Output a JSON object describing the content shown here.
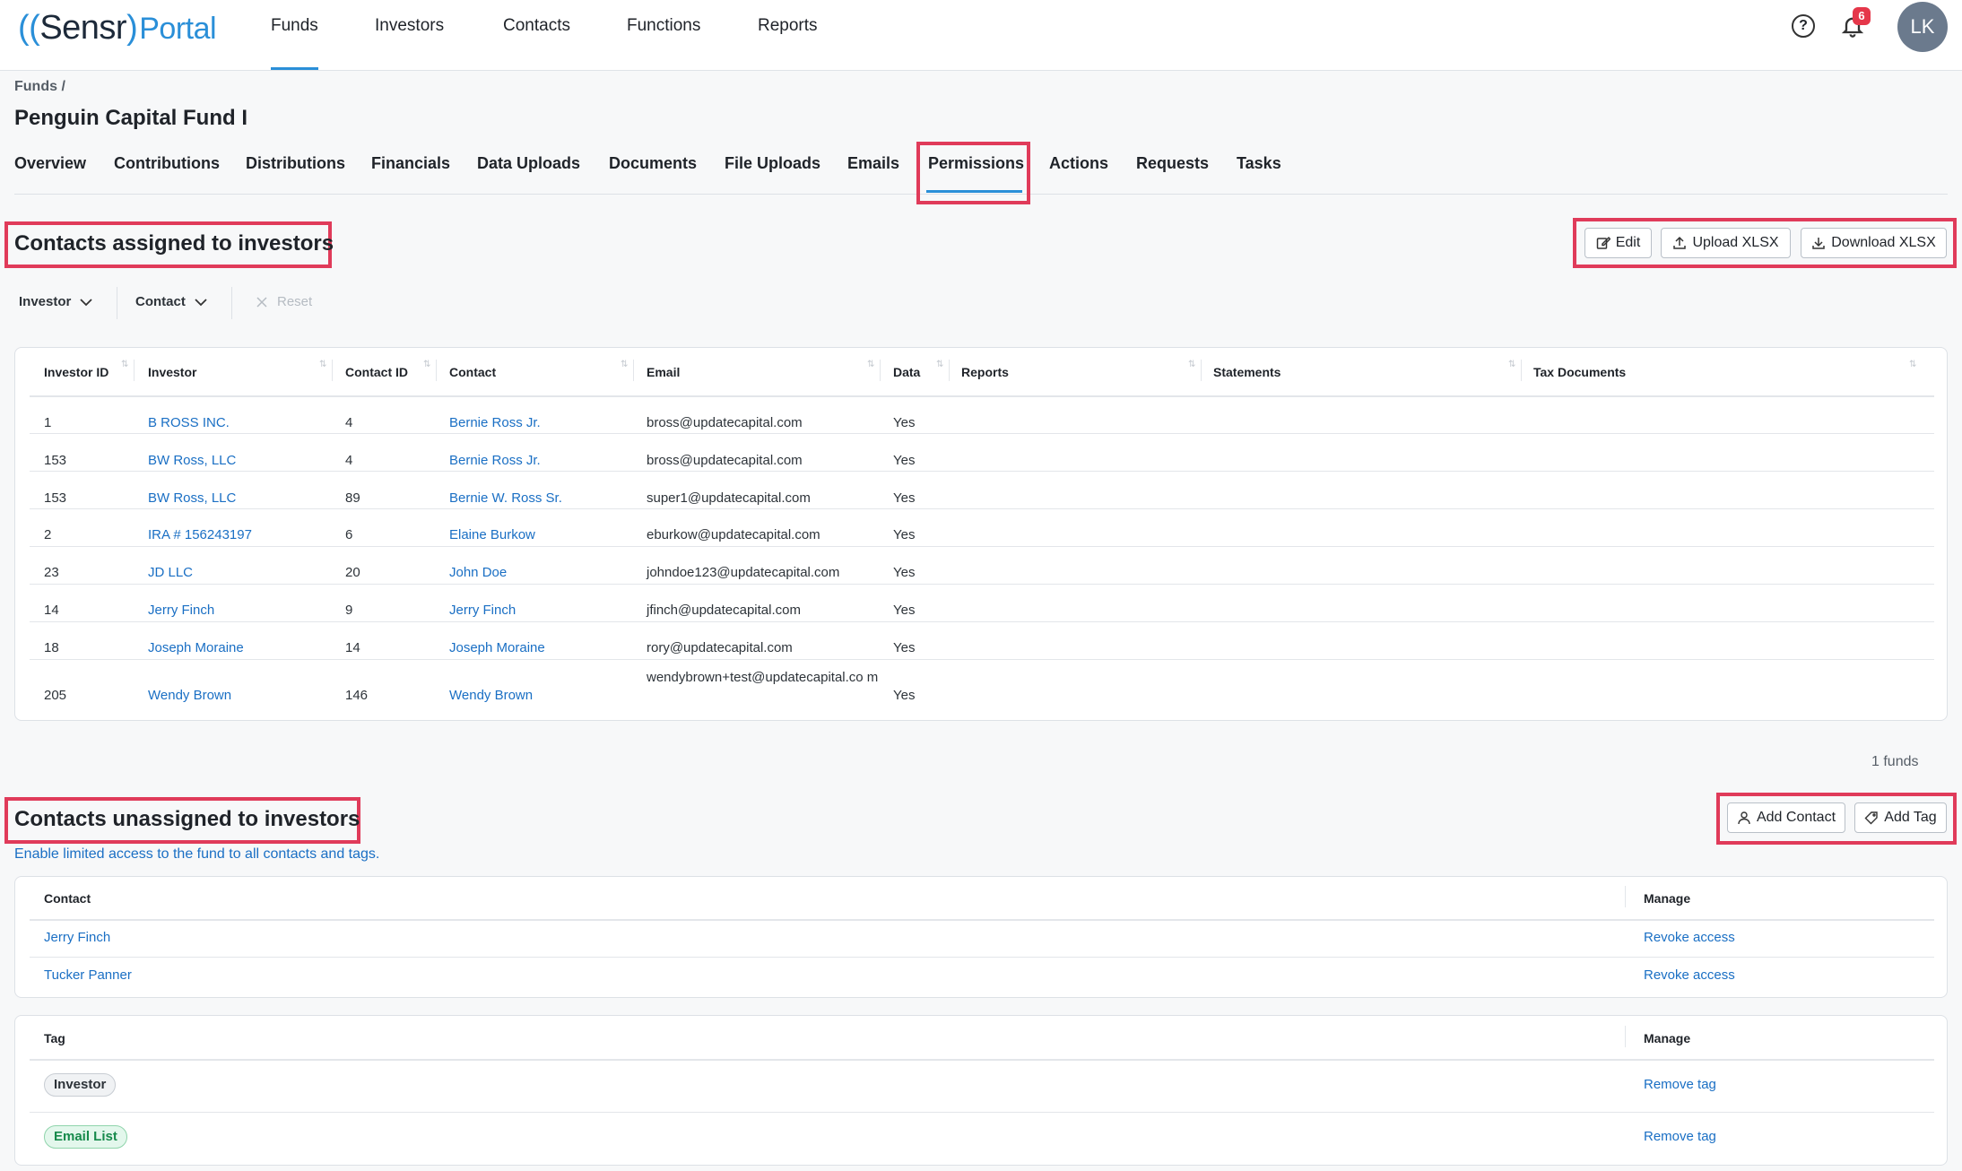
{
  "app": {
    "logo_brand": "Sensr",
    "logo_product": "Portal",
    "user_initials": "LK",
    "notifications_count": "6"
  },
  "nav": {
    "items": [
      "Funds",
      "Investors",
      "Contacts",
      "Functions",
      "Reports"
    ],
    "active": "Funds"
  },
  "breadcrumb": "Funds /",
  "page_title": "Penguin Capital Fund I",
  "tabs": [
    "Overview",
    "Contributions",
    "Distributions",
    "Financials",
    "Data Uploads",
    "Documents",
    "File Uploads",
    "Emails",
    "Permissions",
    "Actions",
    "Requests",
    "Tasks"
  ],
  "active_tab": "Permissions",
  "assigned": {
    "title": "Contacts assigned to investors",
    "buttons": {
      "edit": "Edit",
      "upload": "Upload XLSX",
      "download": "Download XLSX"
    },
    "filters": {
      "investor": "Investor",
      "contact": "Contact",
      "reset": "Reset"
    },
    "columns": [
      "Investor ID",
      "Investor",
      "Contact ID",
      "Contact",
      "Email",
      "Data",
      "Reports",
      "Statements",
      "Tax Documents"
    ],
    "rows": [
      [
        "1",
        "B ROSS INC.",
        "4",
        "Bernie Ross Jr.",
        "bross@updatecapital.com",
        "Yes"
      ],
      [
        "153",
        "BW Ross, LLC",
        "4",
        "Bernie Ross Jr.",
        "bross@updatecapital.com",
        "Yes"
      ],
      [
        "153",
        "BW Ross, LLC",
        "89",
        "Bernie W. Ross Sr.",
        "super1@updatecapital.com",
        "Yes"
      ],
      [
        "2",
        "IRA # 156243197",
        "6",
        "Elaine Burkow",
        "eburkow@updatecapital.com",
        "Yes"
      ],
      [
        "23",
        "JD LLC",
        "20",
        "John Doe",
        "johndoe123@updatecapital.com",
        "Yes"
      ],
      [
        "14",
        "Jerry Finch",
        "9",
        "Jerry Finch",
        "jfinch@updatecapital.com",
        "Yes"
      ],
      [
        "18",
        "Joseph Moraine",
        "14",
        "Joseph Moraine",
        "rory@updatecapital.com",
        "Yes"
      ],
      [
        "205",
        "Wendy Brown",
        "146",
        "Wendy Brown",
        "wendybrown+test@updatecapital.co m",
        "Yes"
      ]
    ],
    "funds_count": "1 funds"
  },
  "unassigned": {
    "title": "Contacts unassigned to investors",
    "subtitle": "Enable limited access to the fund to all contacts and tags.",
    "buttons": {
      "add_contact": "Add Contact",
      "add_tag": "Add Tag"
    },
    "contact_columns": [
      "Contact",
      "Manage"
    ],
    "contacts": [
      {
        "name": "Jerry Finch",
        "action": "Revoke access"
      },
      {
        "name": "Tucker Panner",
        "action": "Revoke access"
      }
    ],
    "tag_columns": [
      "Tag",
      "Manage"
    ],
    "tags": [
      {
        "name": "Investor",
        "action": "Remove tag",
        "color": "#f0f2f4"
      },
      {
        "name": "Email List",
        "action": "Remove tag",
        "color": "#e3f7ec"
      }
    ]
  },
  "colors": {
    "accent": "#2a8fd8",
    "link": "#1a6fc4",
    "highlight": "#e03b5a",
    "badge": "#e5374a"
  }
}
